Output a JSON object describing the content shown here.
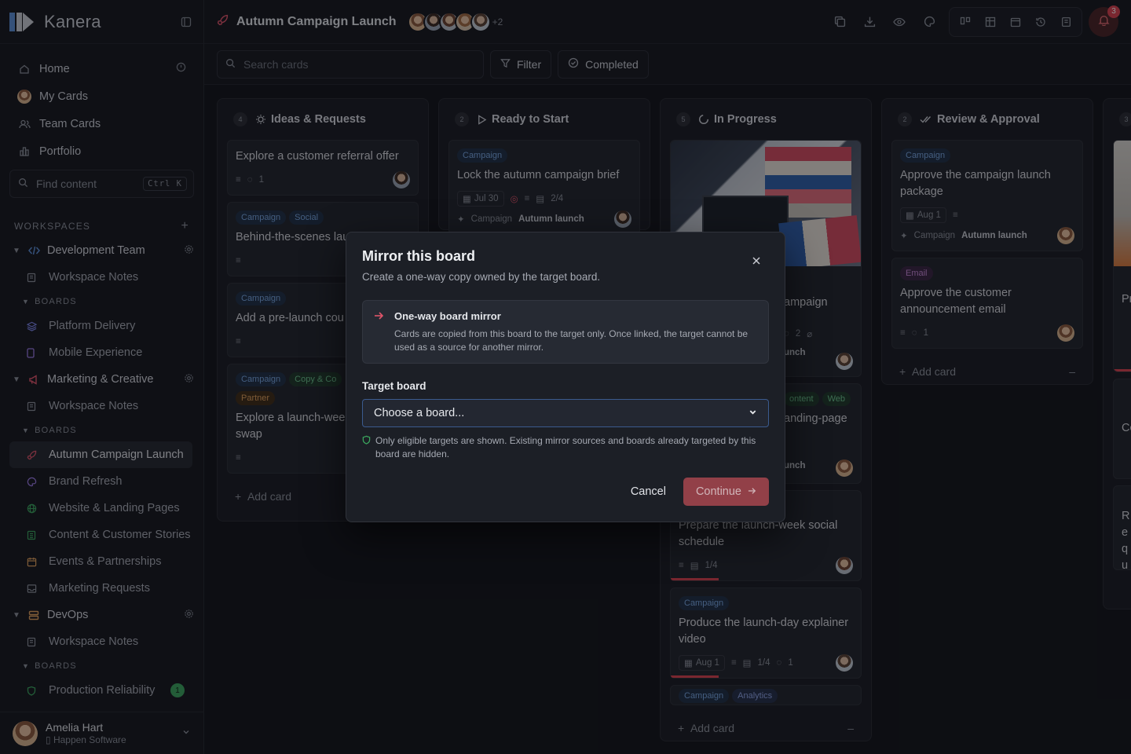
{
  "app": {
    "name": "Kanera",
    "colors": {
      "accent": "#e0556a",
      "success": "#3ba55d",
      "link": "#78a6e0"
    }
  },
  "sidebar": {
    "nav": [
      {
        "label": "Home",
        "icon": "home-icon"
      },
      {
        "label": "My Cards",
        "icon": "avatar"
      },
      {
        "label": "Team Cards",
        "icon": "team-icon"
      },
      {
        "label": "Portfolio",
        "icon": "portfolio-icon"
      }
    ],
    "find": {
      "placeholder": "Find content",
      "shortcut": "Ctrl K"
    },
    "workspaces_label": "WORKSPACES",
    "boards_label": "BOARDS",
    "workspaces": [
      {
        "name": "Development Team",
        "notes": "Workspace Notes",
        "boards": [
          "Platform Delivery",
          "Mobile Experience"
        ]
      },
      {
        "name": "Marketing & Creative",
        "notes": "Workspace Notes",
        "boards": [
          "Autumn Campaign Launch",
          "Brand Refresh",
          "Website & Landing Pages",
          "Content & Customer Stories",
          "Events & Partnerships",
          "Marketing Requests"
        ]
      },
      {
        "name": "DevOps",
        "notes": "Workspace Notes",
        "boards": [
          "Production Reliability"
        ],
        "badge": "1"
      }
    ],
    "user": {
      "name": "Amelia Hart",
      "org": "Happen Software"
    }
  },
  "topbar": {
    "board_title": "Autumn Campaign Launch",
    "extra_members": "+2",
    "notifications": "3"
  },
  "toolbar": {
    "search_placeholder": "Search cards",
    "filter": "Filter",
    "completed": "Completed"
  },
  "columns": [
    {
      "title": "Ideas & Requests",
      "count": "4",
      "cards": [
        {
          "title": "Explore a customer referral offer",
          "comments": "1"
        },
        {
          "tags": [
            "Campaign",
            "Social"
          ],
          "title": "Behind-the-scenes launch diary"
        },
        {
          "tags": [
            "Campaign"
          ],
          "title": "Add a pre-launch cou teaser"
        },
        {
          "tags": [
            "Campaign",
            "Copy & Co",
            "Partner"
          ],
          "title": "Explore a launch-wee content swap"
        }
      ],
      "add": "Add card"
    },
    {
      "title": "Ready to Start",
      "count": "2",
      "cards": [
        {
          "tags": [
            "Campaign"
          ],
          "title": "Lock the autumn campaign brief",
          "date": "Jul 30",
          "checklist": "2/4",
          "project": "Campaign",
          "project_name": "Autumn launch"
        }
      ]
    },
    {
      "title": "In Progress",
      "count": "5",
      "cards": [
        {
          "title": "ampaign",
          "comments": "2",
          "project_name": "unch"
        },
        {
          "tags": [
            "ontent",
            "Web"
          ],
          "title": "anding-page",
          "project_name": "unch"
        },
        {
          "title": "Prepare the launch-week social schedule",
          "checklist": "1/4"
        },
        {
          "tags": [
            "Campaign"
          ],
          "title": "Produce the launch-day explainer video",
          "date": "Aug 1",
          "checklist": "1/4",
          "comments": "1"
        },
        {
          "tags": [
            "Campaign",
            "Analytics"
          ]
        }
      ],
      "add": "Add card"
    },
    {
      "title": "Review & Approval",
      "count": "2",
      "cards": [
        {
          "tags": [
            "Campaign"
          ],
          "title": "Approve the campaign launch package",
          "date": "Aug 1",
          "project": "Campaign",
          "project_name": "Autumn launch"
        },
        {
          "tags": [
            "Email"
          ],
          "title": "Approve the customer announcement email",
          "comments": "1"
        }
      ],
      "add": "Add card"
    },
    {
      "count": "3",
      "cards": [
        {
          "title": "Pr"
        },
        {
          "title": "Cc"
        },
        {
          "title": "Re qu"
        }
      ]
    }
  ],
  "modal": {
    "title": "Mirror this board",
    "subtitle": "Create a one-way copy owned by the target board.",
    "info_title": "One-way board mirror",
    "info_text": "Cards are copied from this board to the target only. Once linked, the target cannot be used as a source for another mirror.",
    "field_label": "Target board",
    "select_value": "Choose a board...",
    "hint": "Only eligible targets are shown. Existing mirror sources and boards already targeted by this board are hidden.",
    "cancel": "Cancel",
    "continue": "Continue"
  }
}
